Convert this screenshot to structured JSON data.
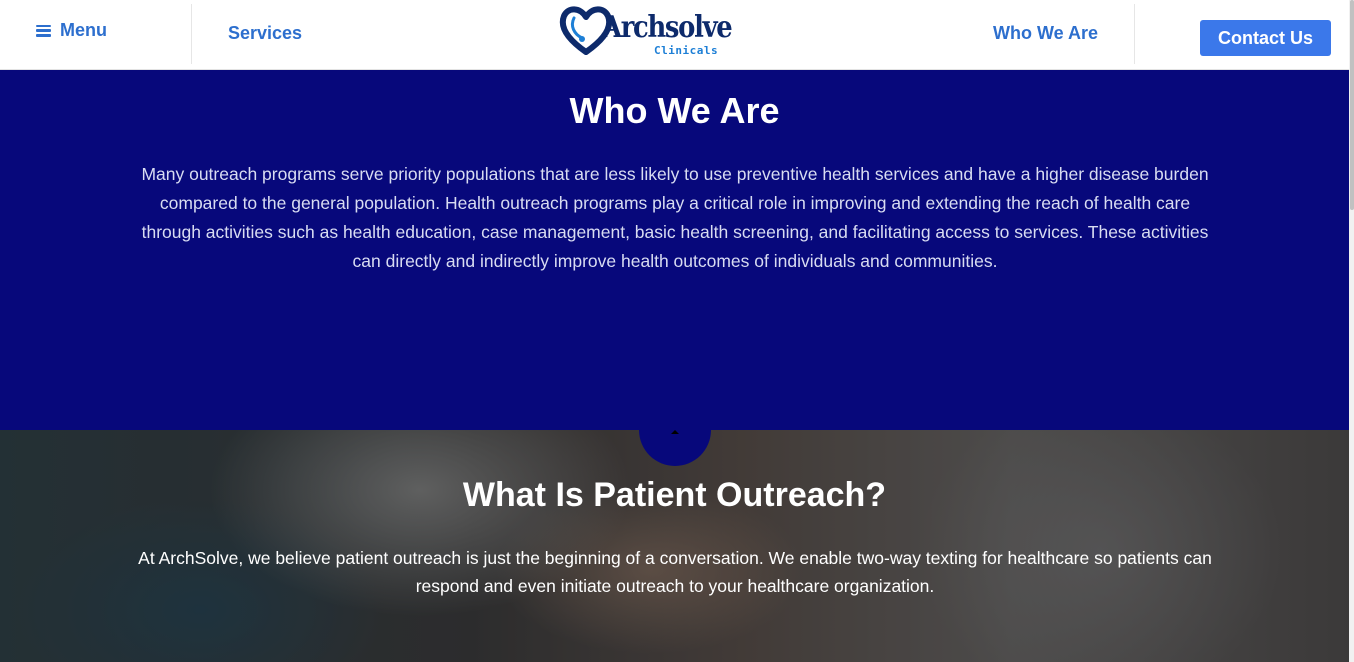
{
  "header": {
    "menu_label": "Menu",
    "nav_left": "Services",
    "nav_right": "Who We Are",
    "logo_main": "Archsolve",
    "logo_sub": "Clinicals",
    "contact_label": "Contact Us"
  },
  "who_we_are": {
    "title": "Who We Are",
    "body": "Many outreach programs serve priority populations that are less likely to use preventive health services and have a higher disease burden compared to the general population. Health outreach programs play a critical role in improving and extending the reach of health care through activities such as health education, case management, basic health screening, and facilitating access to services. These activities can directly and indirectly improve health outcomes of individuals and communities."
  },
  "outreach": {
    "title": "What Is Patient Outreach?",
    "body": "At ArchSolve, we believe patient outreach is just the beginning of a conversation. We enable two-way texting for healthcare so patients can respond and even initiate outreach to your healthcare organization."
  },
  "colors": {
    "brand_blue": "#2d6fce",
    "contact_button": "#3b78ea",
    "section_navy": "#07087b",
    "logo_navy": "#0d2a6b"
  },
  "icons": {
    "menu": "hamburger-icon",
    "logo": "heart-stethoscope-logo",
    "scroll_up": "caret-up-icon"
  }
}
